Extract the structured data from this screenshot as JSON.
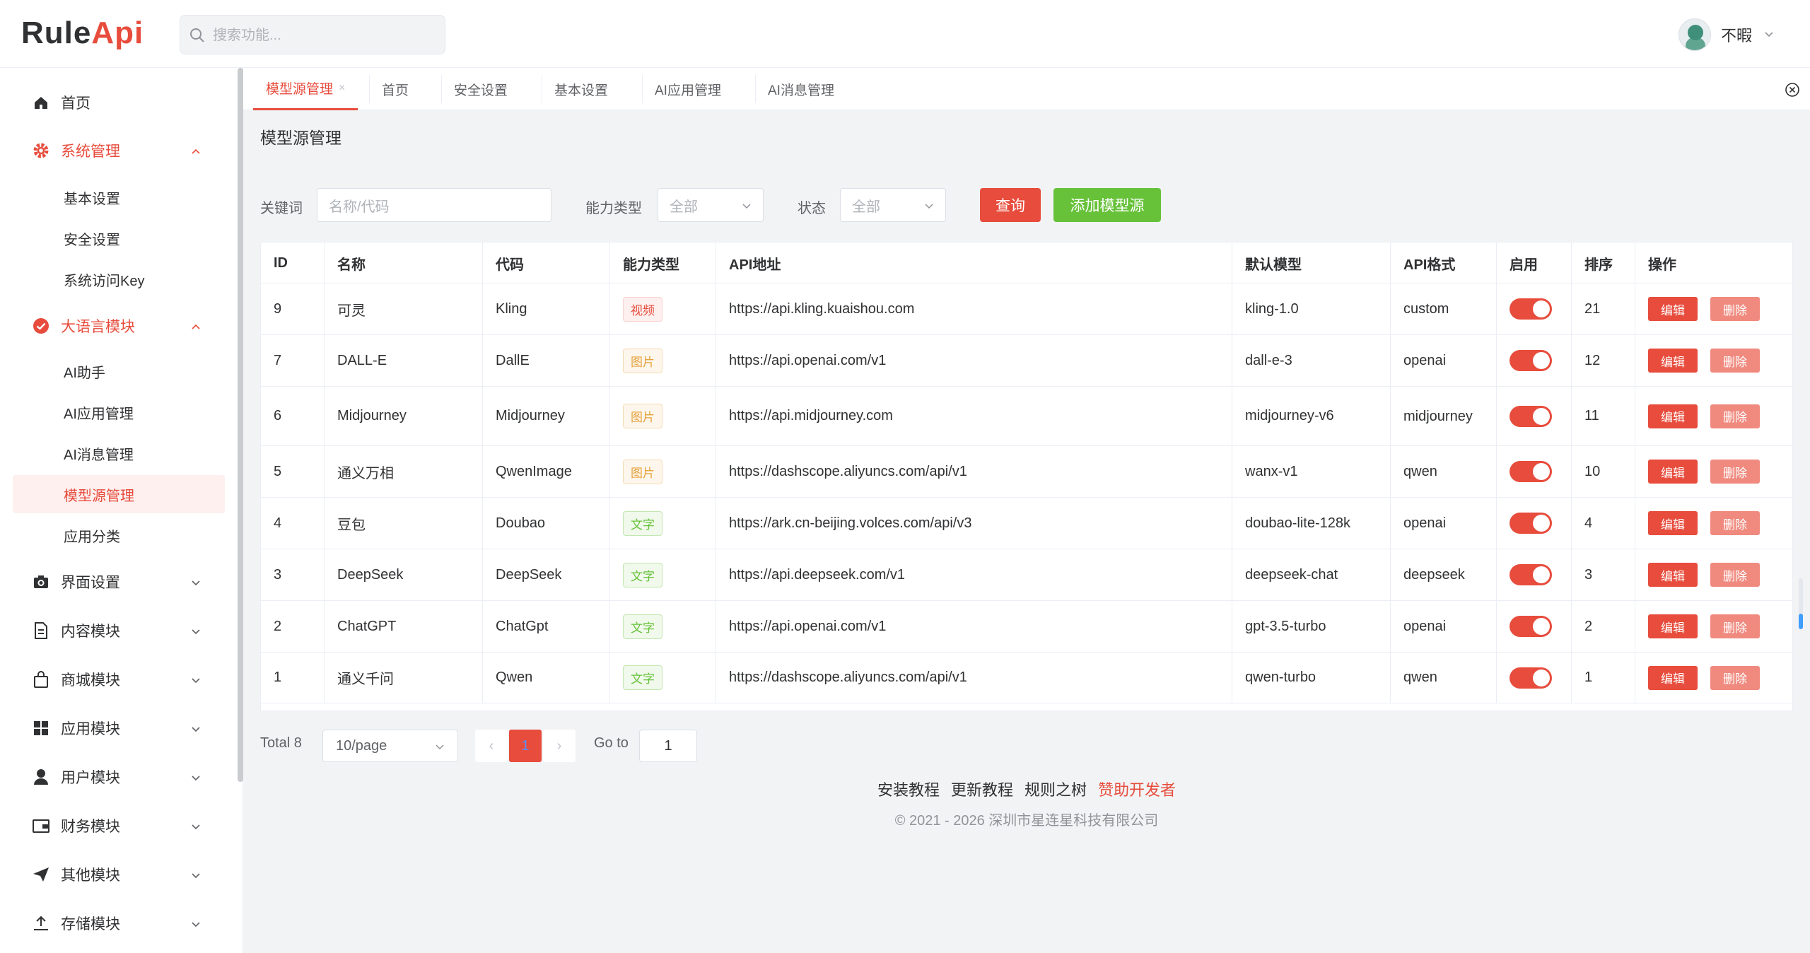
{
  "app": {
    "logo_part1": "Rule",
    "logo_part2": "Api",
    "search_placeholder": "搜索功能...",
    "user_name": "不暇"
  },
  "sidebar": {
    "items": [
      {
        "label": "首页",
        "icon": "home-icon"
      },
      {
        "label": "系统管理",
        "icon": "gear-icon",
        "expanded": true
      },
      {
        "label": "基本设置"
      },
      {
        "label": "安全设置"
      },
      {
        "label": "系统访问Key"
      },
      {
        "label": "大语言模块",
        "icon": "check-circle-icon",
        "expanded": true
      },
      {
        "label": "AI助手"
      },
      {
        "label": "AI应用管理"
      },
      {
        "label": "AI消息管理"
      },
      {
        "label": "模型源管理",
        "active": true
      },
      {
        "label": "应用分类"
      },
      {
        "label": "界面设置",
        "icon": "camera-icon"
      },
      {
        "label": "内容模块",
        "icon": "document-icon"
      },
      {
        "label": "商城模块",
        "icon": "shopping-bag-icon"
      },
      {
        "label": "应用模块",
        "icon": "grid-icon"
      },
      {
        "label": "用户模块",
        "icon": "user-icon"
      },
      {
        "label": "财务模块",
        "icon": "wallet-icon"
      },
      {
        "label": "其他模块",
        "icon": "send-icon"
      },
      {
        "label": "存储模块",
        "icon": "upload-icon"
      }
    ]
  },
  "tabs": [
    "模型源管理",
    "首页",
    "安全设置",
    "基本设置",
    "AI应用管理",
    "AI消息管理"
  ],
  "page": {
    "title": "模型源管理",
    "filters": {
      "keyword_label": "关键词",
      "keyword_placeholder": "名称/代码",
      "type_label": "能力类型",
      "type_value": "全部",
      "status_label": "状态",
      "status_value": "全部",
      "search_button": "查询",
      "add_button": "添加模型源"
    }
  },
  "table": {
    "columns": [
      "ID",
      "名称",
      "代码",
      "能力类型",
      "API地址",
      "默认模型",
      "API格式",
      "启用",
      "排序",
      "操作"
    ],
    "edit_label": "编辑",
    "delete_label": "删除",
    "rows": [
      {
        "id": "9",
        "name": "可灵",
        "code": "Kling",
        "type": "视频",
        "type_kind": "video",
        "api": "https://api.kling.kuaishou.com",
        "model": "kling-1.0",
        "format": "custom",
        "enabled": true,
        "sort": "21"
      },
      {
        "id": "7",
        "name": "DALL-E",
        "code": "DallE",
        "type": "图片",
        "type_kind": "image",
        "api": "https://api.openai.com/v1",
        "model": "dall-e-3",
        "format": "openai",
        "enabled": true,
        "sort": "12"
      },
      {
        "id": "6",
        "name": "Midjourney",
        "code": "Midjourney",
        "type": "图片",
        "type_kind": "image",
        "api": "https://api.midjourney.com",
        "model": "midjourney-v6",
        "format": "midjourney",
        "enabled": true,
        "sort": "11"
      },
      {
        "id": "5",
        "name": "通义万相",
        "code": "QwenImage",
        "type": "图片",
        "type_kind": "image",
        "api": "https://dashscope.aliyuncs.com/api/v1",
        "model": "wanx-v1",
        "format": "qwen",
        "enabled": true,
        "sort": "10"
      },
      {
        "id": "4",
        "name": "豆包",
        "code": "Doubao",
        "type": "文字",
        "type_kind": "text",
        "api": "https://ark.cn-beijing.volces.com/api/v3",
        "model": "doubao-lite-128k",
        "format": "openai",
        "enabled": true,
        "sort": "4"
      },
      {
        "id": "3",
        "name": "DeepSeek",
        "code": "DeepSeek",
        "type": "文字",
        "type_kind": "text",
        "api": "https://api.deepseek.com/v1",
        "model": "deepseek-chat",
        "format": "deepseek",
        "enabled": true,
        "sort": "3"
      },
      {
        "id": "2",
        "name": "ChatGPT",
        "code": "ChatGpt",
        "type": "文字",
        "type_kind": "text",
        "api": "https://api.openai.com/v1",
        "model": "gpt-3.5-turbo",
        "format": "openai",
        "enabled": true,
        "sort": "2"
      },
      {
        "id": "1",
        "name": "通义千问",
        "code": "Qwen",
        "type": "文字",
        "type_kind": "text",
        "api": "https://dashscope.aliyuncs.com/api/v1",
        "model": "qwen-turbo",
        "format": "qwen",
        "enabled": true,
        "sort": "1"
      }
    ]
  },
  "pagination": {
    "total": "Total 8",
    "page_size": "10/page",
    "current_page": "1",
    "goto_label": "Go to",
    "goto_value": "1"
  },
  "footer": {
    "links": [
      "安装教程",
      "更新教程",
      "规则之树"
    ],
    "donate": "赞助开发者",
    "copyright": "© 2021 - 2026 深圳市星连星科技有限公司"
  },
  "colors": {
    "accent": "#e74c3c",
    "success": "#67c23a",
    "warning": "#e6a23c"
  }
}
